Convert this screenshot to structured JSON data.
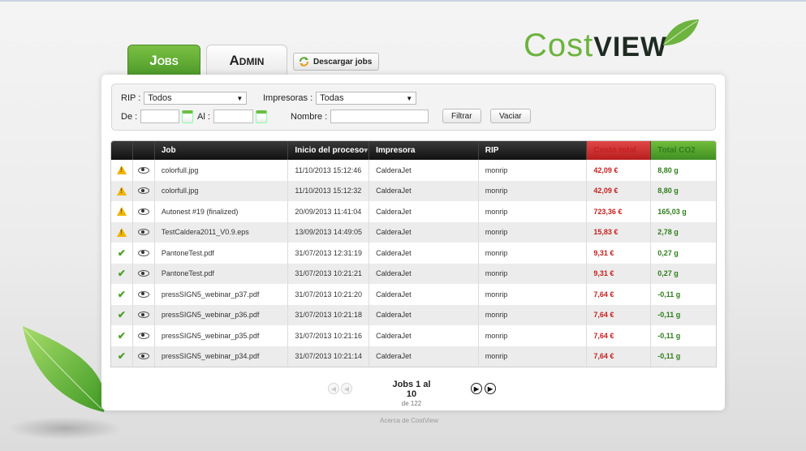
{
  "logo": {
    "part1": "Cost",
    "part2": "VIEW"
  },
  "tabs": {
    "jobs": "Jobs",
    "admin": "Admin"
  },
  "download_button": "Descargar jobs",
  "filters": {
    "rip_label": "RIP :",
    "rip_value": "Todos",
    "printers_label": "Impresoras :",
    "printers_value": "Todas",
    "from_label": "De :",
    "to_label": "Al :",
    "name_label": "Nombre :",
    "filter_button": "Filtrar",
    "clear_button": "Vaciar"
  },
  "table": {
    "headers": {
      "job": "Job",
      "start": "Inicio del proceso",
      "printer": "Impresora",
      "rip": "RIP",
      "cost": "Costo total",
      "co2": "Total CO2"
    },
    "rows": [
      {
        "status": "warning",
        "job": "colorfull.jpg",
        "start": "11/10/2013 15:12:46",
        "printer": "CalderaJet",
        "rip": "monrip",
        "cost": "42,09 €",
        "co2": "8,80 g"
      },
      {
        "status": "warning",
        "job": "colorfull.jpg",
        "start": "11/10/2013 15:12:32",
        "printer": "CalderaJet",
        "rip": "monrip",
        "cost": "42,09 €",
        "co2": "8,80 g"
      },
      {
        "status": "warning",
        "job": "Autonest #19 (finalized)",
        "start": "20/09/2013 11:41:04",
        "printer": "CalderaJet",
        "rip": "monrip",
        "cost": "723,36 €",
        "co2": "165,03 g"
      },
      {
        "status": "warning",
        "job": "TestCaldera2011_V0.9.eps",
        "start": "13/09/2013 14:49:05",
        "printer": "CalderaJet",
        "rip": "monrip",
        "cost": "15,83 €",
        "co2": "2,78 g"
      },
      {
        "status": "ok",
        "job": "PantoneTest.pdf",
        "start": "31/07/2013 12:31:19",
        "printer": "CalderaJet",
        "rip": "monrip",
        "cost": "9,31 €",
        "co2": "0,27 g"
      },
      {
        "status": "ok",
        "job": "PantoneTest.pdf",
        "start": "31/07/2013 10:21:21",
        "printer": "CalderaJet",
        "rip": "monrip",
        "cost": "9,31 €",
        "co2": "0,27 g"
      },
      {
        "status": "ok",
        "job": "pressSIGN5_webinar_p37.pdf",
        "start": "31/07/2013 10:21:20",
        "printer": "CalderaJet",
        "rip": "monrip",
        "cost": "7,64 €",
        "co2": "-0,11 g"
      },
      {
        "status": "ok",
        "job": "pressSIGN5_webinar_p36.pdf",
        "start": "31/07/2013 10:21:18",
        "printer": "CalderaJet",
        "rip": "monrip",
        "cost": "7,64 €",
        "co2": "-0,11 g"
      },
      {
        "status": "ok",
        "job": "pressSIGN5_webinar_p35.pdf",
        "start": "31/07/2013 10:21:16",
        "printer": "CalderaJet",
        "rip": "monrip",
        "cost": "7,64 €",
        "co2": "-0,11 g"
      },
      {
        "status": "ok",
        "job": "pressSIGN5_webinar_p34.pdf",
        "start": "31/07/2013 10:21:14",
        "printer": "CalderaJet",
        "rip": "monrip",
        "cost": "7,64 €",
        "co2": "-0,11 g"
      }
    ]
  },
  "pagination": {
    "main": "Jobs 1 al 10",
    "sub": "de 122"
  },
  "footer": {
    "about": "Acerca de CostView"
  },
  "colors": {
    "accent_green": "#6db33f",
    "cost_red": "#c62020",
    "co2_green": "#2e7d1c"
  },
  "icons": {
    "warning": "warning-icon",
    "ok": "check-icon",
    "view": "eye-icon"
  }
}
